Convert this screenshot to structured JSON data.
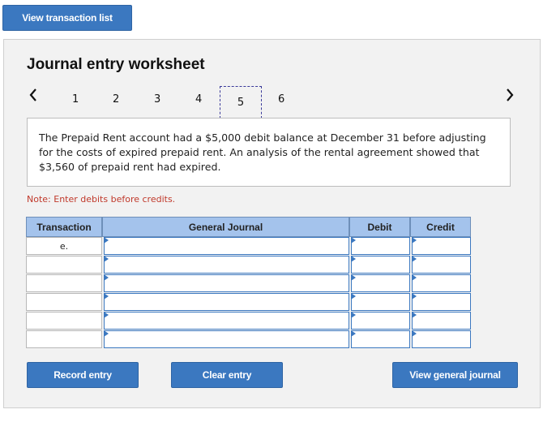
{
  "top_button": {
    "label": "View transaction list"
  },
  "worksheet": {
    "title": "Journal entry worksheet",
    "pages": [
      "1",
      "2",
      "3",
      "4",
      "5",
      "6"
    ],
    "current_page": "5",
    "description": "The Prepaid Rent account had a $5,000 debit balance at December 31 before adjusting for the costs of expired prepaid rent. An analysis of the rental agreement showed that $3,560 of prepaid rent had expired.",
    "note": "Note: Enter debits before credits.",
    "table": {
      "headers": {
        "transaction": "Transaction",
        "journal": "General Journal",
        "debit": "Debit",
        "credit": "Credit"
      },
      "rows": [
        {
          "transaction": "e.",
          "journal": "",
          "debit": "",
          "credit": ""
        },
        {
          "transaction": "",
          "journal": "",
          "debit": "",
          "credit": ""
        },
        {
          "transaction": "",
          "journal": "",
          "debit": "",
          "credit": ""
        },
        {
          "transaction": "",
          "journal": "",
          "debit": "",
          "credit": ""
        },
        {
          "transaction": "",
          "journal": "",
          "debit": "",
          "credit": ""
        },
        {
          "transaction": "",
          "journal": "",
          "debit": "",
          "credit": ""
        }
      ]
    },
    "buttons": {
      "record": "Record entry",
      "clear": "Clear entry",
      "view_journal": "View general journal"
    }
  },
  "colors": {
    "accent": "#3b78c0",
    "header_bg": "#a4c3ec",
    "note": "#c0392b",
    "panel_bg": "#f2f2f2"
  },
  "icons": {
    "prev": "chevron-left-icon",
    "next": "chevron-right-icon",
    "input_marker": "triangle-marker-icon"
  }
}
